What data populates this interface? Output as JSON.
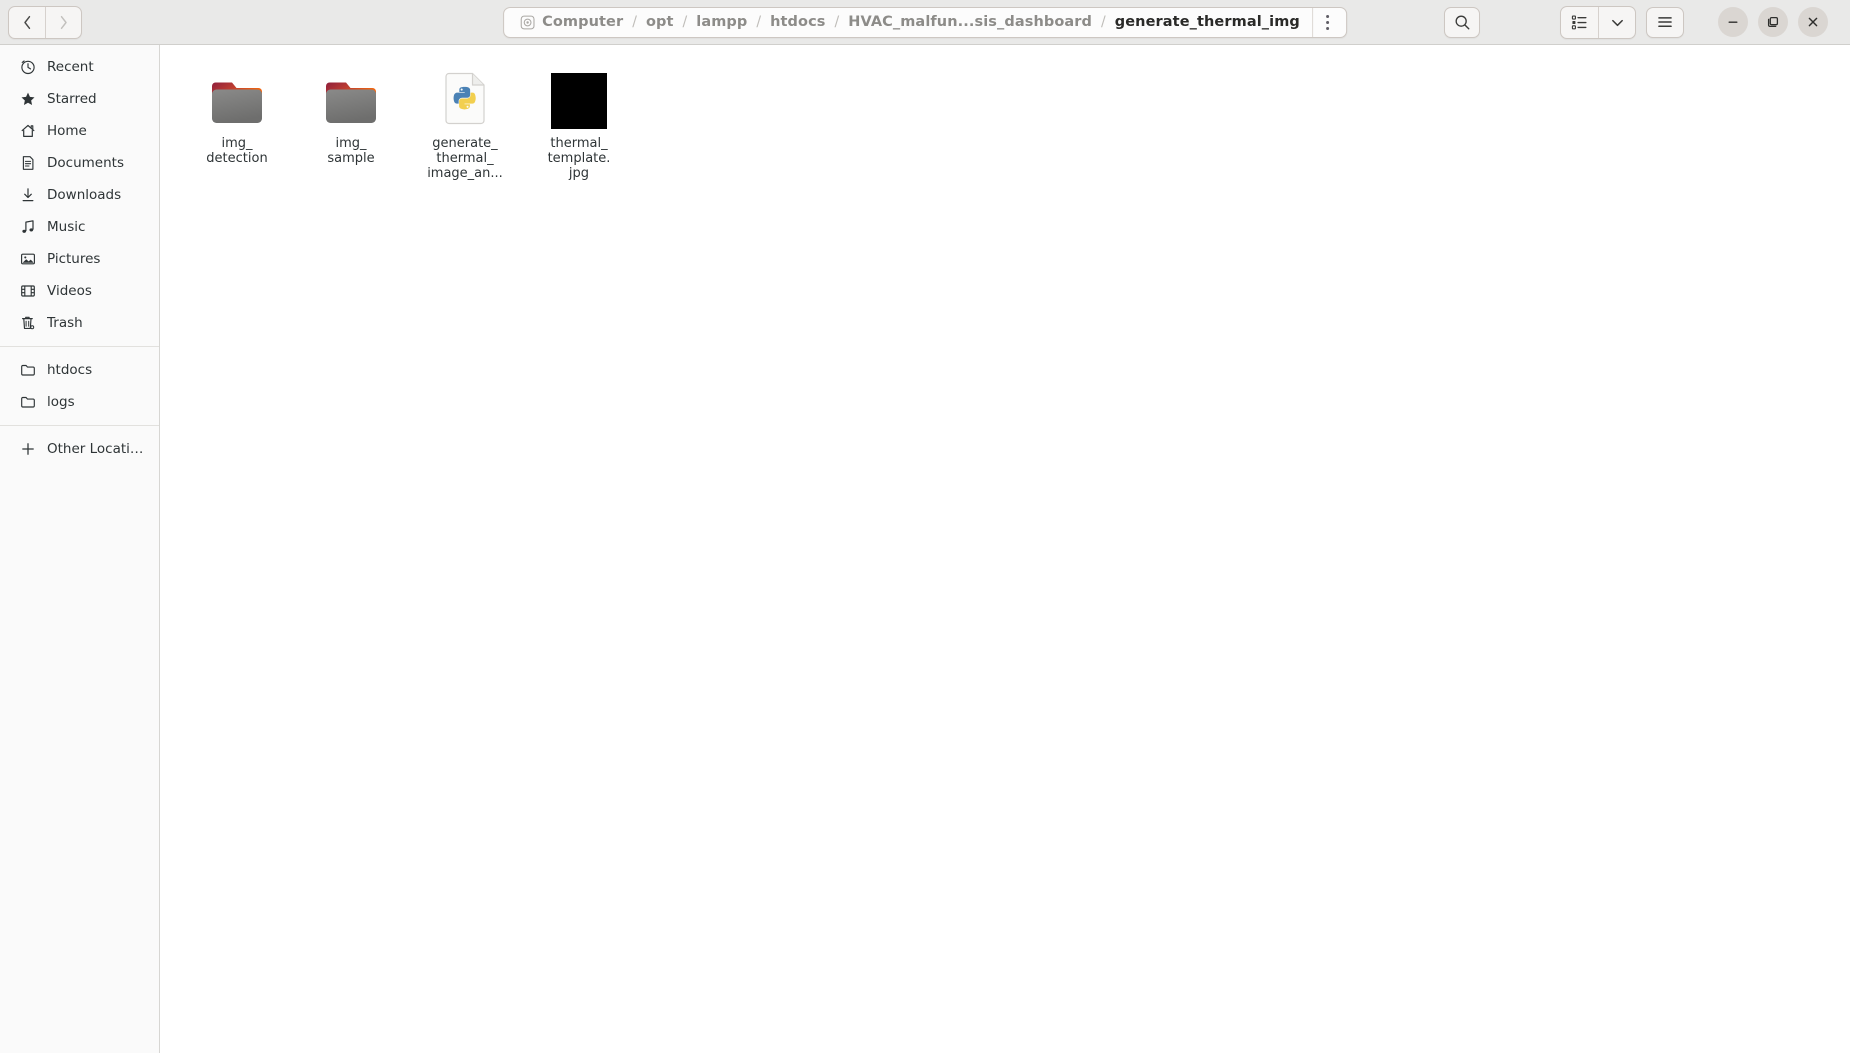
{
  "window": {
    "title": "generate_thermal_img",
    "controls": {
      "minimize": "minimize",
      "maximize": "maximize",
      "close": "close"
    }
  },
  "header": {
    "back_label": "Back",
    "forward_label": "Forward",
    "path_menu_label": "Path menu",
    "search_label": "Search",
    "view_list_label": "View options",
    "view_dropdown_label": "View dropdown",
    "main_menu_label": "Main menu",
    "breadcrumbs": [
      {
        "label": "Computer",
        "icon": "drive-icon",
        "current": false
      },
      {
        "label": "opt",
        "current": false
      },
      {
        "label": "lampp",
        "current": false
      },
      {
        "label": "htdocs",
        "current": false
      },
      {
        "label": "HVAC_malfun...sis_dashboard",
        "current": false
      },
      {
        "label": "generate_thermal_img",
        "current": true
      }
    ],
    "separator": "/"
  },
  "sidebar": {
    "groups": [
      {
        "items": [
          {
            "label": "Recent",
            "icon": "clock-icon"
          },
          {
            "label": "Starred",
            "icon": "star-icon"
          },
          {
            "label": "Home",
            "icon": "home-icon"
          },
          {
            "label": "Documents",
            "icon": "document-icon"
          },
          {
            "label": "Downloads",
            "icon": "download-icon"
          },
          {
            "label": "Music",
            "icon": "music-icon"
          },
          {
            "label": "Pictures",
            "icon": "picture-icon"
          },
          {
            "label": "Videos",
            "icon": "video-icon"
          },
          {
            "label": "Trash",
            "icon": "trash-icon"
          }
        ]
      },
      {
        "items": [
          {
            "label": "htdocs",
            "icon": "folder-icon"
          },
          {
            "label": "logs",
            "icon": "folder-icon"
          }
        ]
      },
      {
        "items": [
          {
            "label": "Other Locations",
            "icon": "plus-icon"
          }
        ]
      }
    ]
  },
  "files": [
    {
      "name": "img_\ndetection",
      "type": "folder",
      "icon": "folder-icon"
    },
    {
      "name": "img_\nsample",
      "type": "folder",
      "icon": "folder-icon"
    },
    {
      "name": "generate_\nthermal_\nimage_an...",
      "type": "python-file",
      "icon": "python-file-icon"
    },
    {
      "name": "thermal_\ntemplate.\njpg",
      "type": "image-file",
      "icon": "image-thumbnail"
    }
  ],
  "colors": {
    "headerbar": "#e9e9e8",
    "sidebar": "#fafafa",
    "content": "#ffffff",
    "text": "#2e3436",
    "crumb_inactive": "#8d8c89",
    "crumb_active": "#2a2a28",
    "folder_body": "#777777",
    "folder_tab_start": "#a4273f",
    "folder_tab_end": "#e8690f",
    "python_blue": "#4b8bbe",
    "python_yellow": "#f3d04e",
    "thumbnail_black": "#000000"
  }
}
